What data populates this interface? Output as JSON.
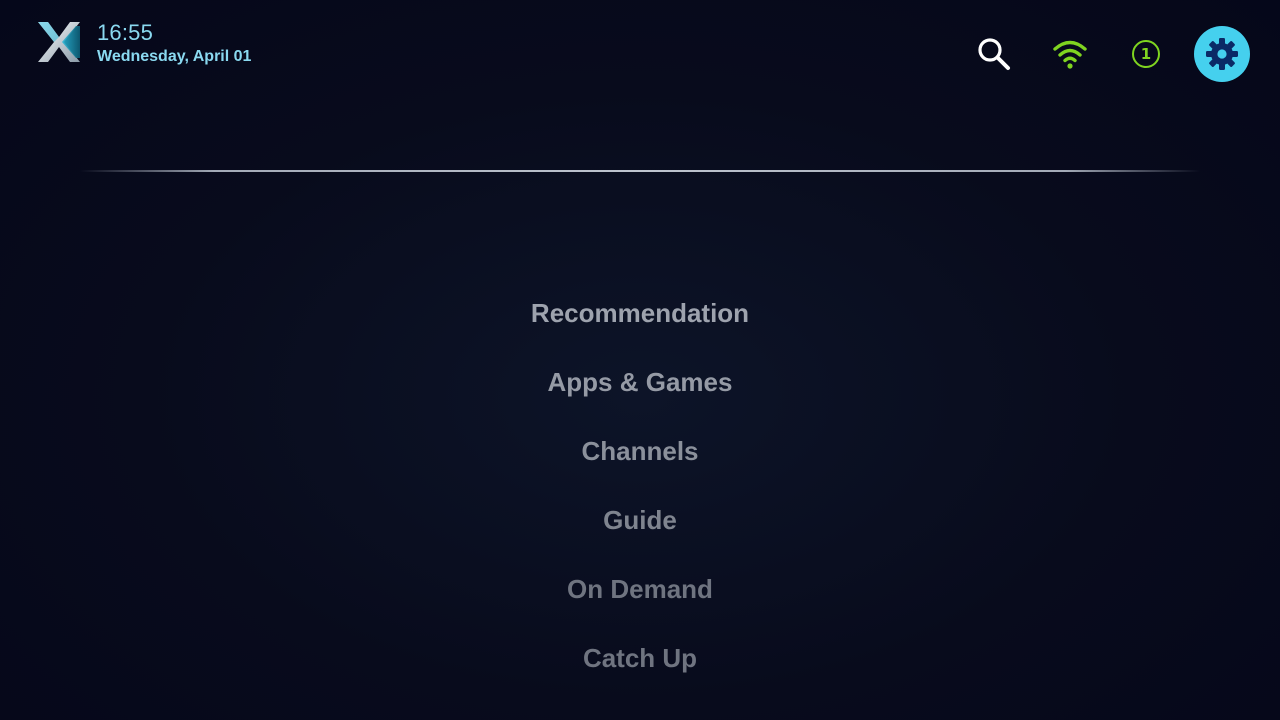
{
  "header": {
    "time": "16:55",
    "date": "Wednesday, April 01",
    "notification_count": "1",
    "logo_icon": "x-logo-icon",
    "icons": [
      "search-icon",
      "wifi-icon",
      "notification-icon",
      "gear-icon"
    ]
  },
  "menu": {
    "items": [
      {
        "label": "Recommendation"
      },
      {
        "label": "Apps & Games"
      },
      {
        "label": "Channels"
      },
      {
        "label": "Guide"
      },
      {
        "label": "On Demand"
      },
      {
        "label": "Catch Up"
      }
    ]
  },
  "colors": {
    "background": "#060818",
    "accent": "#45d0ee",
    "clock": "#8ad9f0",
    "wifi": "#7fd420",
    "menu_text": "#a4a9b4"
  }
}
